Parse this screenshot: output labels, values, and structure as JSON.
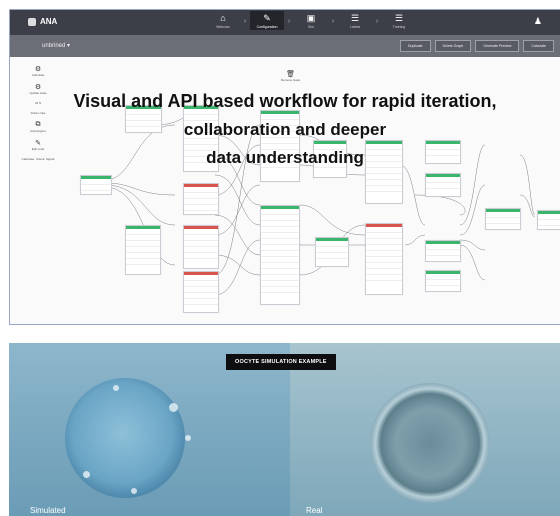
{
  "app": {
    "name": "ANA"
  },
  "steps": [
    {
      "label": "Webcam",
      "icon": "home-icon"
    },
    {
      "label": "Configuration",
      "icon": "brush-icon",
      "active": true
    },
    {
      "label": "Sim",
      "icon": "car-icon"
    },
    {
      "label": "Labels",
      "icon": "database-icon"
    },
    {
      "label": "Training",
      "icon": "database-stack-icon"
    }
  ],
  "project": {
    "name": "unbrined ▾"
  },
  "actions": [
    "Duplicate",
    "Delete Graph",
    "Generate Preview",
    "Calculate"
  ],
  "tools": [
    {
      "icon": "gear-icon",
      "label": "Calculate"
    },
    {
      "icon": "gear-icon",
      "label": "Update state"
    },
    {
      "icon": "value-icon",
      "label": "42 N"
    },
    {
      "icon": "",
      "label": "Draw Links"
    },
    {
      "icon": "plugin-icon",
      "label": "Add plugins"
    },
    {
      "icon": "pencil-icon",
      "label": "Edit code"
    },
    {
      "icon": "",
      "label": "Calculate, Check, Signal"
    }
  ],
  "canvas_toolbar": {
    "label": "Remove Gaps"
  },
  "headline": {
    "line1": "Visual and API based workflow for rapid iteration,",
    "line2": "collaboration and deeper",
    "line3": "data understanding"
  },
  "example": {
    "badge": "OOCYTE SIMULATION EXAMPLE",
    "left_caption": "Simulated",
    "right_caption": "Real"
  }
}
